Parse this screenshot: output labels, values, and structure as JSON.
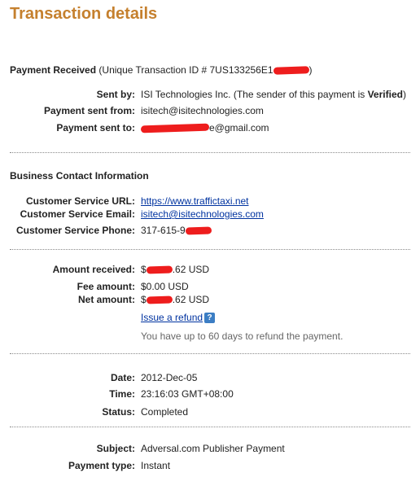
{
  "title": "Transaction details",
  "payment": {
    "heading": "Payment Received",
    "id_prefix": "(Unique Transaction ID # 7US133256E1",
    "id_suffix": ")",
    "sent_by_label": "Sent by:",
    "sent_by_value": "ISI Technologies Inc. (The sender of this payment is ",
    "sent_by_verified": "Verified",
    "sent_by_end": ")",
    "from_label": "Payment sent from:",
    "from_value": "isitech@isitechnologies.com",
    "to_label": "Payment sent to:",
    "to_value_prefix": "",
    "to_value_suffix": "e@gmail.com"
  },
  "business": {
    "heading": "Business Contact Information",
    "url_label": "Customer Service URL:",
    "url_value": "https://www.traffictaxi.net",
    "email_label": "Customer Service Email:",
    "email_value": "isitech@isitechnologies.com",
    "phone_label": "Customer Service Phone:",
    "phone_value_prefix": "317-615-9"
  },
  "amounts": {
    "received_label": "Amount received:",
    "received_prefix": "$",
    "received_suffix": ".62 USD",
    "fee_label": "Fee amount:",
    "fee_value": "$0.00 USD",
    "net_label": "Net amount:",
    "net_prefix": "$",
    "net_suffix": ".62 USD",
    "refund_link": "Issue a refund",
    "help_icon": "?",
    "refund_note": "You have up to 60 days to refund the payment."
  },
  "details": {
    "date_label": "Date:",
    "date_value": "2012-Dec-05",
    "time_label": "Time:",
    "time_value": "23:16:03 GMT+08:00",
    "status_label": "Status:",
    "status_value": "Completed"
  },
  "misc": {
    "subject_label": "Subject:",
    "subject_value": "Adversal.com Publisher Payment",
    "type_label": "Payment type:",
    "type_value": "Instant"
  },
  "colors": {
    "title": "#c5802e",
    "link": "#0033a0",
    "redaction": "#ee1d1d"
  }
}
